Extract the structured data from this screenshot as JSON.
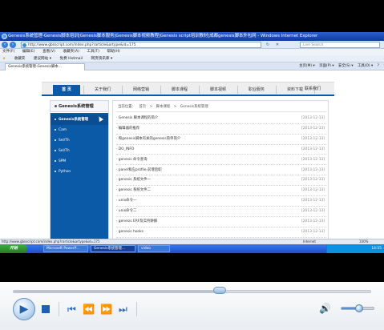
{
  "browser": {
    "window_title": "Genesis系统管理-Genesis脚本培训|Genesis脚本服务|Genesis脚本视频教程|Genesis script培训教材|成都genesis脚本外包网 - Windows Internet Explorer",
    "url": "http://www.gbsscript.com/index.php?rarticle&artype&id=175",
    "search_placeholder": "Live Search",
    "menu": [
      "文件(F)",
      "编辑(E)",
      "查看(V)",
      "收藏夹(A)",
      "工具(T)",
      "帮助(H)"
    ],
    "favorites": [
      "收藏夹",
      "建议网站 ▾",
      "免费 Hotmail",
      "网页快讯库 ▾"
    ],
    "tab_label": "Genesis系统管理-Genesis脚本...",
    "tab_tools": [
      "主页(M) ▾",
      "页面(P) ▾",
      "安全(S) ▾",
      "工具(O) ▾",
      "?"
    ],
    "status_url": "http://www.gbsscript.com/index.php?rarticle&artype&id=175",
    "status_zone": "Internet",
    "status_zoom": "100%"
  },
  "site": {
    "nav": [
      "首 页",
      "关于我们",
      "网络营销",
      "脚本课程",
      "脚本视频",
      "职业服务",
      "资料下载",
      "联系我们"
    ],
    "nav_active_index": 0,
    "sidebar_title": "Genesis系统管理",
    "sidebar_items": [
      "Genesis系统管理",
      "Cam",
      "Sel/Th",
      "Sel/Th",
      "SPM",
      "Python"
    ],
    "sidebar_active_index": 0,
    "breadcrumb": [
      "当前位置：",
      "首页",
      ">",
      "脚本课程",
      ">",
      "Genesis系统管理"
    ],
    "articles": [
      {
        "title": "· Genesis 脚本课程的简介",
        "date": "[2013-12-13]"
      },
      {
        "title": "· 编辑器的推荐",
        "date": "[2013-12-13]"
      },
      {
        "title": "· 和genesis脚本有关的genesis简单简介",
        "date": "[2013-12-13]"
      },
      {
        "title": "· DO_INFO",
        "date": "[2013-12-13]"
      },
      {
        "title": "· genesis 命令查询",
        "date": "[2013-12-13]"
      },
      {
        "title": "· panel和应profile 前增后职",
        "date": "[2013-12-13]"
      },
      {
        "title": "· genesis 系统文件一",
        "date": "[2013-12-13]"
      },
      {
        "title": "· genesis 系统文件二",
        "date": "[2013-12-13]"
      },
      {
        "title": "· unix命令一",
        "date": "[2013-12-13]"
      },
      {
        "title": "· unix命令二",
        "date": "[2013-12-13]"
      },
      {
        "title": "· genesis ERF及实例讲解",
        "date": "[2013-12-13]"
      },
      {
        "title": "· genesis hooks",
        "date": "[2013-12-13]"
      }
    ]
  },
  "taskbar": {
    "start_label": "开始",
    "tasks": [
      "Microsoft PowerP...",
      "Genesis系统管理...",
      "video"
    ],
    "active_task_index": 1,
    "tray_time": "14:55"
  },
  "player": {
    "seek_progress": 0.58,
    "volume_level": 0.55
  }
}
